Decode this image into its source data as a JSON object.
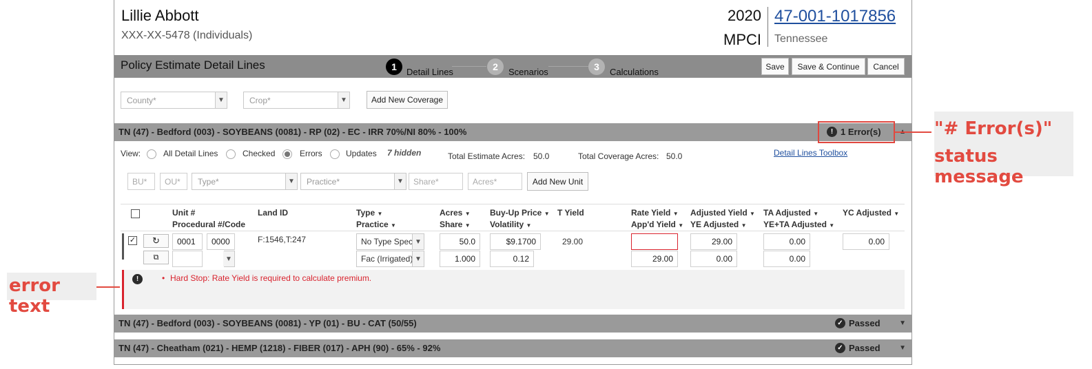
{
  "header": {
    "client_name": "Lillie Abbott",
    "client_id": "XXX-XX-5478 (Individuals)",
    "year": "2020",
    "insurance_type": "MPCI",
    "policy_number": "47-001-1017856",
    "state": "Tennessee"
  },
  "titlebar": {
    "title": "Policy Estimate Detail Lines",
    "steps": [
      {
        "num": "1",
        "label": "Detail Lines"
      },
      {
        "num": "2",
        "label": "Scenarios"
      },
      {
        "num": "3",
        "label": "Calculations"
      }
    ],
    "save_label": "Save",
    "save_continue_label": "Save & Continue",
    "cancel_label": "Cancel"
  },
  "coverage_form": {
    "county_placeholder": "County*",
    "crop_placeholder": "Crop*",
    "add_button": "Add New Coverage"
  },
  "groups": [
    {
      "title": "TN (47) - Bedford (003) - SOYBEANS (0081) - RP (02) - EC - IRR 70%/NI 80% - 100%",
      "status": "1 Error(s)"
    },
    {
      "title": "TN (47) - Bedford (003) - SOYBEANS (0081) - YP (01) - BU - CAT (50/55)",
      "status": "Passed"
    },
    {
      "title": "TN (47) - Cheatham (021) - HEMP (1218) - FIBER (017) - APH (90) - 65% - 92%",
      "status": "Passed"
    }
  ],
  "view": {
    "label": "View:",
    "options": [
      "All Detail Lines",
      "Checked",
      "Errors",
      "Updates"
    ],
    "selected": "Errors",
    "hidden": "7 hidden",
    "total_estimate_label": "Total Estimate Acres:",
    "total_estimate_value": "50.0",
    "total_coverage_label": "Total Coverage Acres:",
    "total_coverage_value": "50.0",
    "toolbox_link": "Detail Lines Toolbox"
  },
  "unit_form": {
    "bu": "BU*",
    "ou": "OU*",
    "type": "Type*",
    "practice": "Practice*",
    "share": "Share*",
    "acres": "Acres*",
    "add_button": "Add New Unit"
  },
  "columns": {
    "unit": "Unit #",
    "procedural": "Procedural #/Code",
    "land_id": "Land ID",
    "type": "Type",
    "practice": "Practice",
    "acres": "Acres",
    "share": "Share",
    "buyup": "Buy-Up Price",
    "volatility": "Volatility",
    "t_yield": "T Yield",
    "rate_yield": "Rate Yield",
    "appd_yield": "App'd Yield",
    "adjusted_yield": "Adjusted Yield",
    "ye_adjusted": "YE Adjusted",
    "ta_adjusted": "TA Adjusted",
    "ye_ta_adjusted": "YE+TA Adjusted",
    "yc_adjusted": "YC Adjusted"
  },
  "row": {
    "checked": true,
    "unit": "0001",
    "unit2": "0000",
    "land_id": "F:1546,T:247",
    "type": "No Type Spec",
    "practice": "Fac (Irrigated)",
    "acres": "50.0",
    "share": "1.000",
    "buyup_price": "$9.1700",
    "volatility": "0.12",
    "t_yield": "29.00",
    "rate_yield": "",
    "appd_yield": "29.00",
    "adjusted_yield": "29.00",
    "ye_adjusted": "0.00",
    "ta_adjusted": "0.00",
    "ye_ta_adjusted": "0.00",
    "yc_adjusted": "0.00"
  },
  "error_message": "Hard Stop: Rate Yield is required to calculate premium.",
  "annotations": {
    "status_line1": "\"# Error(s)\"",
    "status_line2": "status message",
    "error_text": "error text"
  },
  "colors": {
    "accent_link": "#1f4f9e",
    "error_red": "#d9232e",
    "annotation_red": "#e24a40",
    "bar_gray": "#8c8c8c"
  }
}
